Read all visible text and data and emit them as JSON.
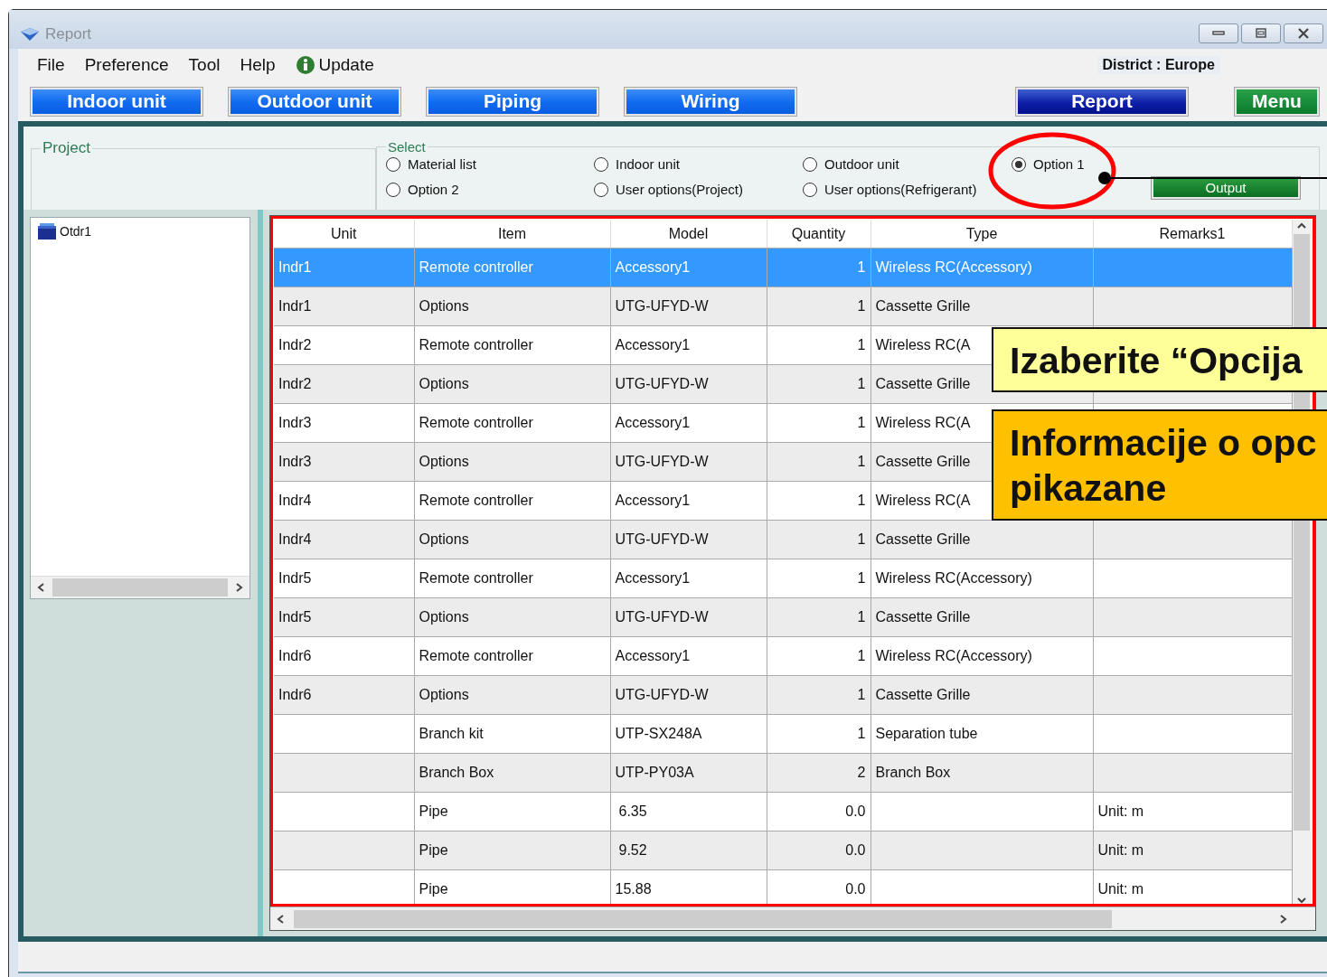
{
  "window": {
    "title": "Report"
  },
  "menu": [
    {
      "label": "File",
      "kind": "plain"
    },
    {
      "label": "Preference",
      "kind": "plain"
    },
    {
      "label": "Tool",
      "kind": "plain"
    },
    {
      "label": "Help",
      "kind": "plain"
    },
    {
      "label": "Update",
      "kind": "info"
    }
  ],
  "district": "District : Europe",
  "nav_buttons": [
    {
      "label": "Indoor unit",
      "kind": "tab",
      "selected": false
    },
    {
      "label": "Outdoor unit",
      "kind": "tab",
      "selected": false
    },
    {
      "label": "Piping",
      "kind": "tab",
      "selected": false
    },
    {
      "label": "Wiring",
      "kind": "tab",
      "selected": false
    },
    {
      "label": "Report",
      "kind": "tab",
      "selected": true
    },
    {
      "label": "Menu",
      "kind": "menu",
      "selected": false
    }
  ],
  "project": {
    "legend": "Project"
  },
  "select": {
    "legend": "Select",
    "options": [
      {
        "label": "Material list",
        "selected": false
      },
      {
        "label": "Indoor unit",
        "selected": false
      },
      {
        "label": "Outdoor unit",
        "selected": false
      },
      {
        "label": "Option 1",
        "selected": true
      },
      {
        "label": "Option 2",
        "selected": false
      },
      {
        "label": "User options(Project)",
        "selected": false
      },
      {
        "label": "User options(Refrigerant)",
        "selected": false
      }
    ],
    "output_button": "Output"
  },
  "tree": {
    "items": [
      {
        "label": "Otdr1"
      }
    ]
  },
  "table": {
    "columns": [
      "Unit",
      "Item",
      "Model",
      "Quantity",
      "Type",
      "Remarks1"
    ],
    "rows": [
      {
        "selected": true,
        "cells": [
          "Indr1",
          "Remote controller",
          "Accessory1",
          "1",
          "Wireless RC(Accessory)",
          ""
        ]
      },
      {
        "selected": false,
        "cells": [
          "Indr1",
          "Options",
          "UTG-UFYD-W",
          "1",
          "Cassette Grille",
          ""
        ]
      },
      {
        "selected": false,
        "cells": [
          "Indr2",
          "Remote controller",
          "Accessory1",
          "1",
          "Wireless RC(A",
          ""
        ]
      },
      {
        "selected": false,
        "cells": [
          "Indr2",
          "Options",
          "UTG-UFYD-W",
          "1",
          "Cassette Grille",
          ""
        ]
      },
      {
        "selected": false,
        "cells": [
          "Indr3",
          "Remote controller",
          "Accessory1",
          "1",
          "Wireless RC(A",
          ""
        ]
      },
      {
        "selected": false,
        "cells": [
          "Indr3",
          "Options",
          "UTG-UFYD-W",
          "1",
          "Cassette Grille",
          ""
        ]
      },
      {
        "selected": false,
        "cells": [
          "Indr4",
          "Remote controller",
          "Accessory1",
          "1",
          "Wireless RC(A",
          ""
        ]
      },
      {
        "selected": false,
        "cells": [
          "Indr4",
          "Options",
          "UTG-UFYD-W",
          "1",
          "Cassette Grille",
          ""
        ]
      },
      {
        "selected": false,
        "cells": [
          "Indr5",
          "Remote controller",
          "Accessory1",
          "1",
          "Wireless RC(Accessory)",
          ""
        ]
      },
      {
        "selected": false,
        "cells": [
          "Indr5",
          "Options",
          "UTG-UFYD-W",
          "1",
          "Cassette Grille",
          ""
        ]
      },
      {
        "selected": false,
        "cells": [
          "Indr6",
          "Remote controller",
          "Accessory1",
          "1",
          "Wireless RC(Accessory)",
          ""
        ]
      },
      {
        "selected": false,
        "cells": [
          "Indr6",
          "Options",
          "UTG-UFYD-W",
          "1",
          "Cassette Grille",
          ""
        ]
      },
      {
        "selected": false,
        "cells": [
          "",
          "Branch kit",
          "UTP-SX248A",
          "1",
          "Separation tube",
          ""
        ]
      },
      {
        "selected": false,
        "cells": [
          "",
          "Branch Box",
          "UTP-PY03A",
          "2",
          "Branch Box",
          ""
        ]
      },
      {
        "selected": false,
        "cells": [
          "",
          "Pipe",
          "6.35",
          "0.0",
          "",
          "Unit: m"
        ]
      },
      {
        "selected": false,
        "cells": [
          "",
          "Pipe",
          "9.52",
          "0.0",
          "",
          "Unit: m"
        ]
      },
      {
        "selected": false,
        "cells": [
          "",
          "Pipe",
          "15.88",
          "0.0",
          "",
          "Unit: m"
        ]
      }
    ]
  },
  "callouts": [
    {
      "kind": "instruction",
      "lines": [
        "Izaberite “Opcija"
      ]
    },
    {
      "kind": "info",
      "lines": [
        "Informacije o opc",
        "pikazane"
      ]
    }
  ]
}
